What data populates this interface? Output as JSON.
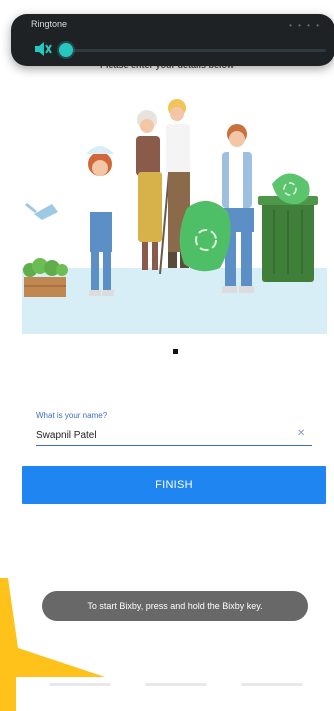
{
  "volume": {
    "title": "Ringtone",
    "level": 0.02,
    "icon": "mute-icon",
    "accent": "#27c7c0"
  },
  "instruction": "Please enter your details below",
  "onboarding": {
    "illustration": "recycling-volunteers-illustration",
    "current_page": 1,
    "page_count": 1
  },
  "form": {
    "name_label": "What is your name?",
    "name_value": "Swapnil Patel"
  },
  "finish_label": "FINISH",
  "toast": "To start Bixby, press and hold the Bixby key.",
  "colors": {
    "primary": "#1f86f1",
    "link": "#3b6ec6",
    "toast_bg": "#686868",
    "corner_accent": "#ffc21a"
  }
}
